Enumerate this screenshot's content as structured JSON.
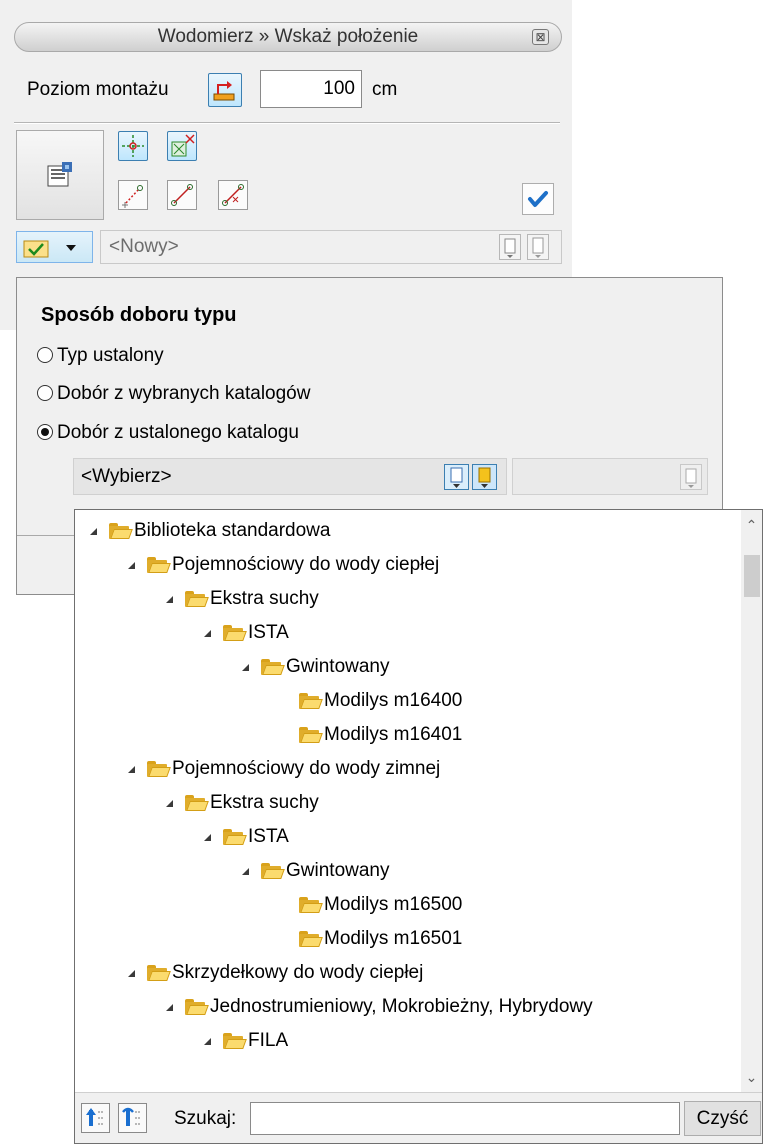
{
  "window": {
    "title": "Wodomierz » Wskaż położenie",
    "close_glyph": "⊠"
  },
  "level": {
    "label": "Poziom montażu",
    "value": "100",
    "unit": "cm"
  },
  "type_combo": {
    "value": "<Nowy>"
  },
  "popup": {
    "heading": "Sposób doboru typu",
    "options": [
      {
        "label": "Typ ustalony",
        "checked": false
      },
      {
        "label": "Dobór z wybranych katalogów",
        "checked": false
      },
      {
        "label": "Dobór z ustalonego katalogu",
        "checked": true
      }
    ],
    "catalog_value": "<Wybierz>"
  },
  "tree": {
    "items": [
      {
        "label": "Biblioteka standardowa",
        "level": 0,
        "expanded": true
      },
      {
        "label": "Pojemnościowy do wody ciepłej",
        "level": 1,
        "expanded": true
      },
      {
        "label": "Ekstra suchy",
        "level": 2,
        "expanded": true
      },
      {
        "label": "ISTA",
        "level": 3,
        "expanded": true
      },
      {
        "label": "Gwintowany",
        "level": 4,
        "expanded": true
      },
      {
        "label": "Modilys m16400",
        "level": 5,
        "expanded": null
      },
      {
        "label": "Modilys m16401",
        "level": 5,
        "expanded": null
      },
      {
        "label": "Pojemnościowy do wody zimnej",
        "level": 1,
        "expanded": true
      },
      {
        "label": "Ekstra suchy",
        "level": 2,
        "expanded": true
      },
      {
        "label": "ISTA",
        "level": 3,
        "expanded": true
      },
      {
        "label": "Gwintowany",
        "level": 4,
        "expanded": true
      },
      {
        "label": "Modilys m16500",
        "level": 5,
        "expanded": null
      },
      {
        "label": "Modilys m16501",
        "level": 5,
        "expanded": null
      },
      {
        "label": "Skrzydełkowy do wody ciepłej",
        "level": 1,
        "expanded": true
      },
      {
        "label": "Jednostrumieniowy, Mokrobieżny, Hybrydowy",
        "level": 2,
        "expanded": true
      },
      {
        "label": "FILA",
        "level": 3,
        "expanded": true
      }
    ]
  },
  "search": {
    "label": "Szukaj:",
    "value": "",
    "clear_label": "Czyść"
  },
  "icons": {
    "scroll_up": "⌃",
    "scroll_down": "⌄"
  }
}
